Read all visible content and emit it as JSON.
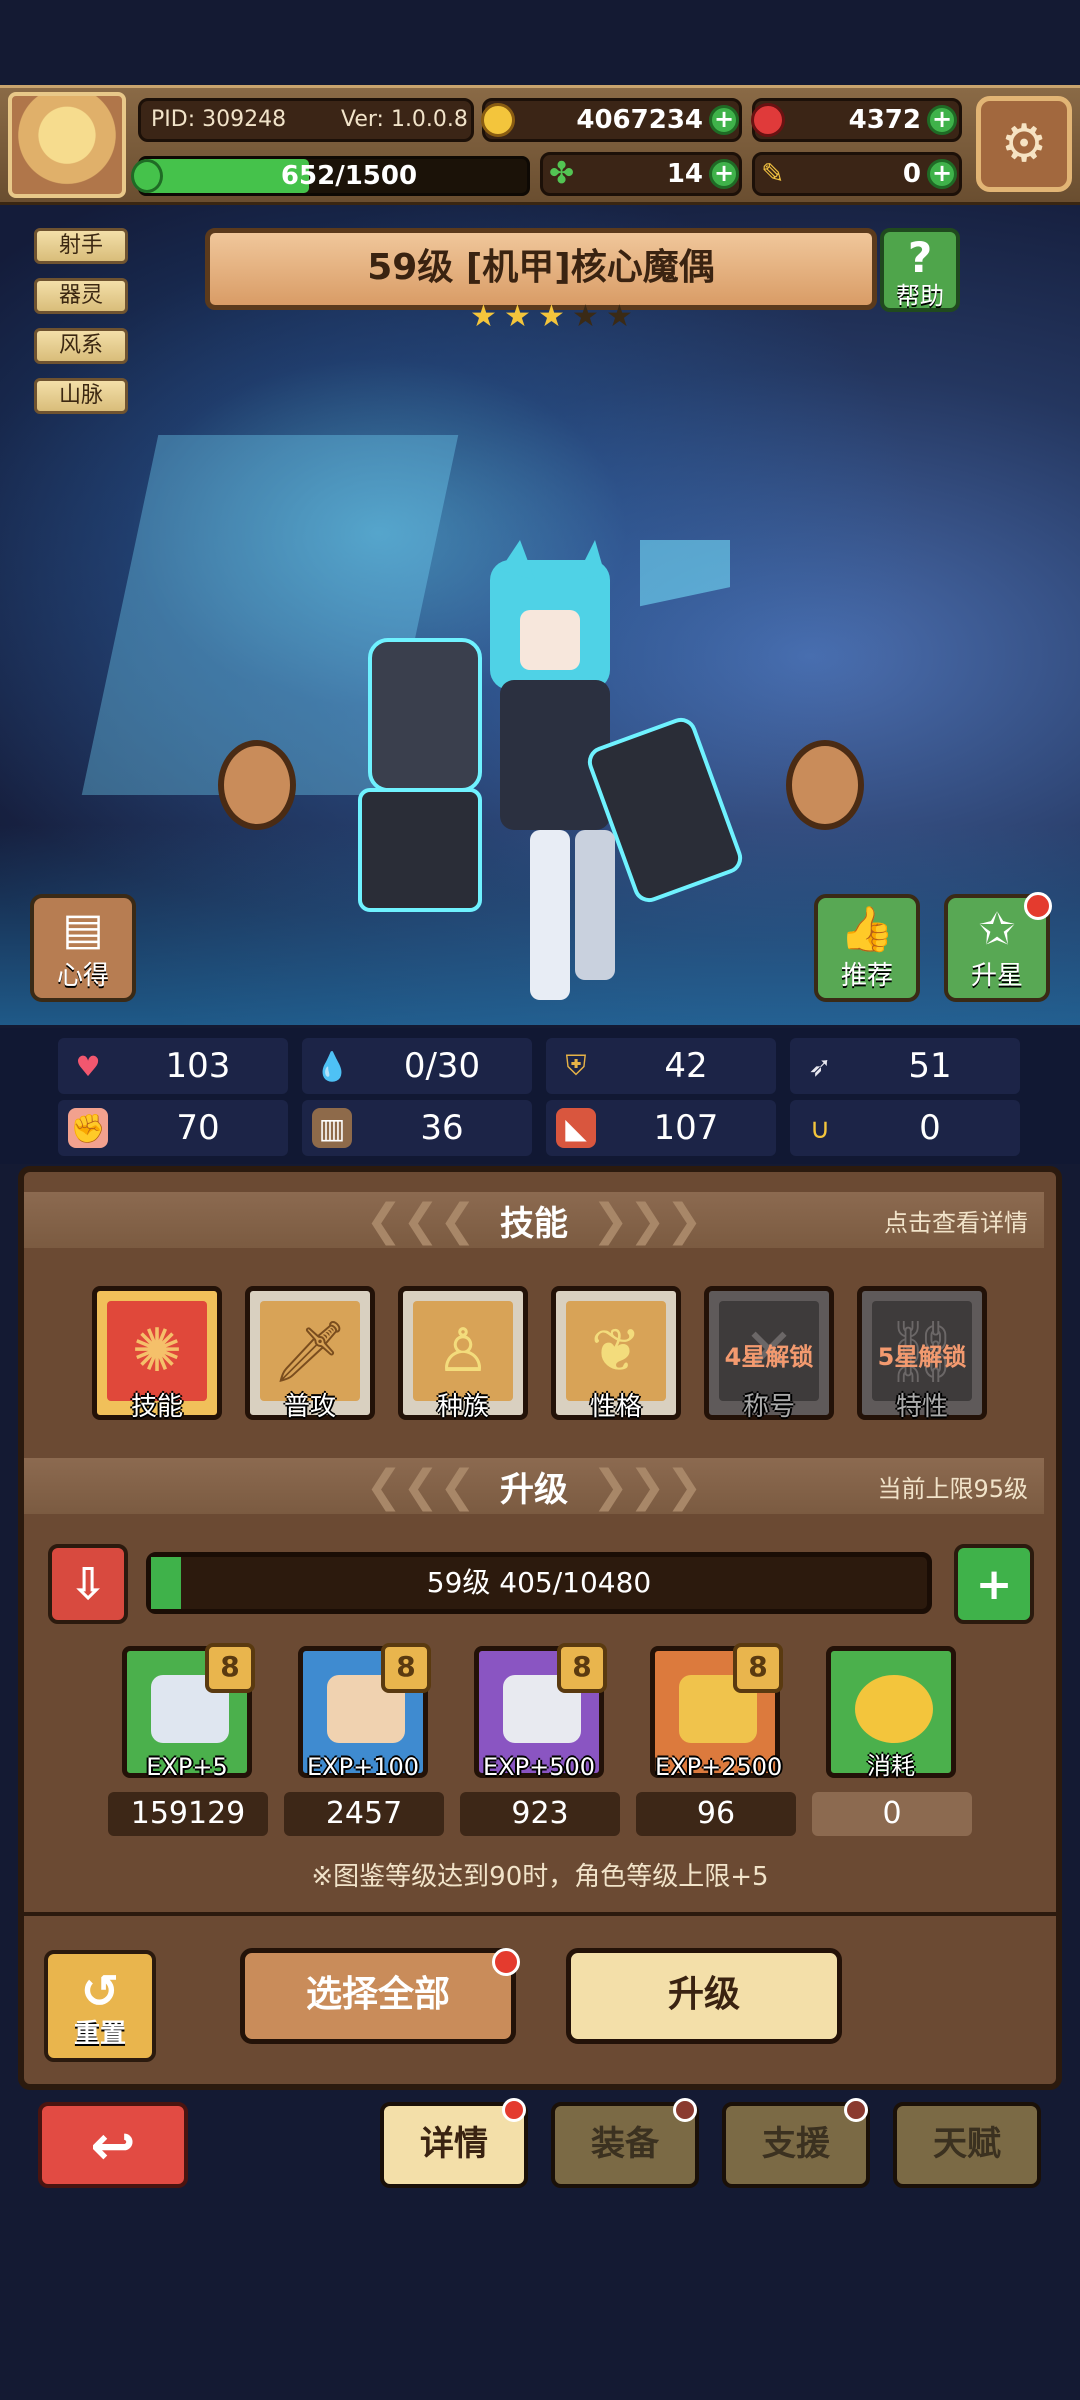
{
  "header": {
    "pid": "PID: 309248",
    "version": "Ver: 1.0.0.8",
    "gold": "4067234",
    "gems": "4372",
    "exp": "652/1500",
    "exp_fraction": 0.435,
    "clovers": "14",
    "tickets": "0"
  },
  "tags": [
    "射手",
    "器灵",
    "风系",
    "山脉"
  ],
  "hero": {
    "title": "59级 [机甲]核心魔偶",
    "stars_filled": 3,
    "stars_total": 5
  },
  "buttons": {
    "help": "帮助",
    "insight": "心得",
    "recommend": "推荐",
    "star_up": "升星"
  },
  "stats": {
    "hp": "103",
    "mana": "0/30",
    "defense": "42",
    "speed": "51",
    "attack": "70",
    "magic": "36",
    "crit": "107",
    "luck": "0"
  },
  "skills_section": {
    "title": "技能",
    "hint": "点击查看详情",
    "items": [
      {
        "label": "技能",
        "locked": ""
      },
      {
        "label": "普攻",
        "locked": ""
      },
      {
        "label": "种族",
        "locked": ""
      },
      {
        "label": "性格",
        "locked": ""
      },
      {
        "label": "称号",
        "locked": "4星解锁"
      },
      {
        "label": "特性",
        "locked": "5星解锁"
      }
    ]
  },
  "upgrade_section": {
    "title": "升级",
    "hint": "当前上限95级",
    "level_text": "59级  405/10480",
    "level_fraction": 0.0387,
    "items": [
      {
        "label": "EXP+5",
        "count": "159129",
        "badge": "8"
      },
      {
        "label": "EXP+100",
        "count": "2457",
        "badge": "8"
      },
      {
        "label": "EXP+500",
        "count": "923",
        "badge": "8"
      },
      {
        "label": "EXP+2500",
        "count": "96",
        "badge": "8"
      },
      {
        "label": "消耗",
        "count": "0",
        "badge": ""
      }
    ],
    "note": "※图鉴等级达到90时，角色等级上限+5"
  },
  "actions": {
    "reset": "重置",
    "select_all": "选择全部",
    "upgrade": "升级"
  },
  "tabs": [
    "详情",
    "装备",
    "支援",
    "天赋"
  ],
  "colors": {
    "panel": "#6b4a33",
    "accent_green": "#3fb24a",
    "badge_red": "#e43b2e"
  }
}
